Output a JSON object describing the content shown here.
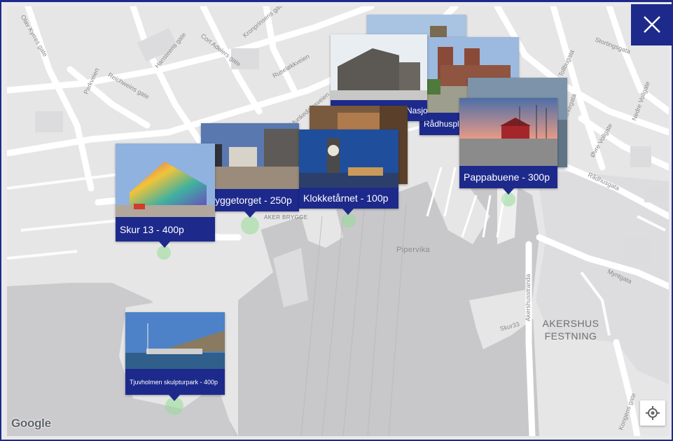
{
  "map": {
    "streets": [
      "Olav Kyrres gate",
      "Hansteens gate",
      "Cort Adelers gate",
      "Kronprinsens gate",
      "Ruselokkveien",
      "Parkveien",
      "Reichweins gate",
      "Dronning Mauds gate",
      "Stortingsgata",
      "Nedre Vollgate",
      "Øvre Vollgate",
      "Rådhusgata",
      "Myntgata",
      "Akershusstranda",
      "Skur33",
      "Kongens gate"
    ],
    "street_short": {
      "s0": "Olav Kyrres gate",
      "s1": "Hansteens gate",
      "s2": "Cort Adelers gate",
      "s3": "Kronprinsens gate",
      "s4": "Ruseløkkveien",
      "s5": "Parkveien",
      "s6": "Reichweins gate",
      "s7": "Dronning Mauds gate",
      "s8": "Stortingsgata",
      "s9": "Nedre Vollgate",
      "s10": "Øvre Vollgate",
      "s11": "Rådhusgata",
      "s12": "Myntgata",
      "s13": "Akershusstranda",
      "s14": "Skur33",
      "s15": "Kongens gate",
      "s16": "Munkedamsveien",
      "s17": "Tollbugata",
      "s18": "Kirkegata"
    },
    "area_labels": {
      "pipervika": "Pipervika",
      "aker_brygge": "AKER BRYGGE",
      "akershus_line1": "AKERSHUS",
      "akershus_line2": "FESTNING"
    },
    "attribution": "Google"
  },
  "cards": {
    "skur13": {
      "title": "Skur 13 - 400p"
    },
    "bryggetorget": {
      "title": "Bryggetorget - 250p"
    },
    "klokketarnet": {
      "title": "Klokketårnet - 100p"
    },
    "pappabuene": {
      "title": "Pappabuene - 300p"
    },
    "radhusplassen": {
      "title": "Rådhusplassen - 100p"
    },
    "nasjonalmuseet": {
      "title": "Nasjonalmuseet - 150p"
    },
    "tjuvholmen": {
      "title": "Tjuvholmen skulpturpark - 400p"
    }
  },
  "controls": {
    "close_icon": "close-icon",
    "locate_icon": "crosshair-icon"
  },
  "colors": {
    "accent": "#1d2a8c",
    "map_bg": "#e6e6e7",
    "water": "#c9c9cb",
    "road": "#ffffff",
    "marker": "#9fdc9f"
  }
}
